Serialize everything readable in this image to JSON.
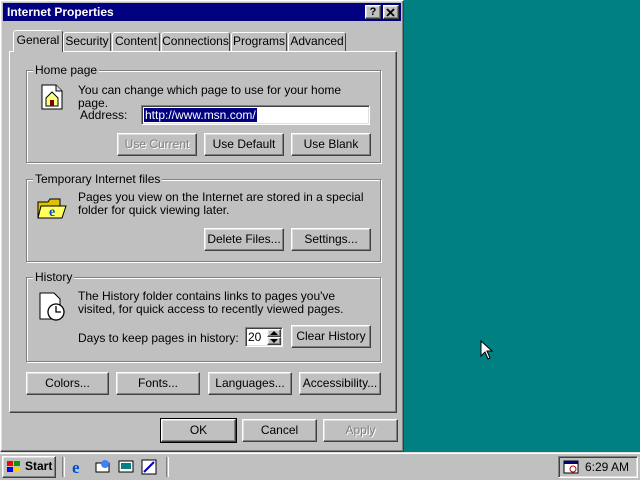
{
  "window": {
    "title": "Internet Properties",
    "help_label": "?",
    "close_label": "x"
  },
  "tabs": [
    {
      "label": "General",
      "active": true
    },
    {
      "label": "Security"
    },
    {
      "label": "Content"
    },
    {
      "label": "Connections"
    },
    {
      "label": "Programs"
    },
    {
      "label": "Advanced"
    }
  ],
  "home_page": {
    "legend": "Home page",
    "description": "You can change which page to use for your home page.",
    "address_label": "Address:",
    "address_value": "http://www.msn.com/",
    "buttons": {
      "use_current": "Use Current",
      "use_default": "Use Default",
      "use_blank": "Use Blank"
    }
  },
  "temp_files": {
    "legend": "Temporary Internet files",
    "description": "Pages you view on the Internet are stored in a special folder for quick viewing later.",
    "buttons": {
      "delete_files": "Delete Files...",
      "settings": "Settings..."
    }
  },
  "history": {
    "legend": "History",
    "description": "The History folder contains links to pages you've visited, for quick access to recently viewed pages.",
    "days_label": "Days to keep pages in history:",
    "days_value": "20",
    "clear_label": "Clear History"
  },
  "bottom_buttons": {
    "colors": "Colors...",
    "fonts": "Fonts...",
    "languages": "Languages...",
    "accessibility": "Accessibility..."
  },
  "dialog_buttons": {
    "ok": "OK",
    "cancel": "Cancel",
    "apply": "Apply"
  },
  "taskbar": {
    "start_label": "Start",
    "clock": "6:29 AM"
  },
  "colors": {
    "desktop": "#008080",
    "titlebar": "#000080",
    "face": "#c0c0c0"
  }
}
